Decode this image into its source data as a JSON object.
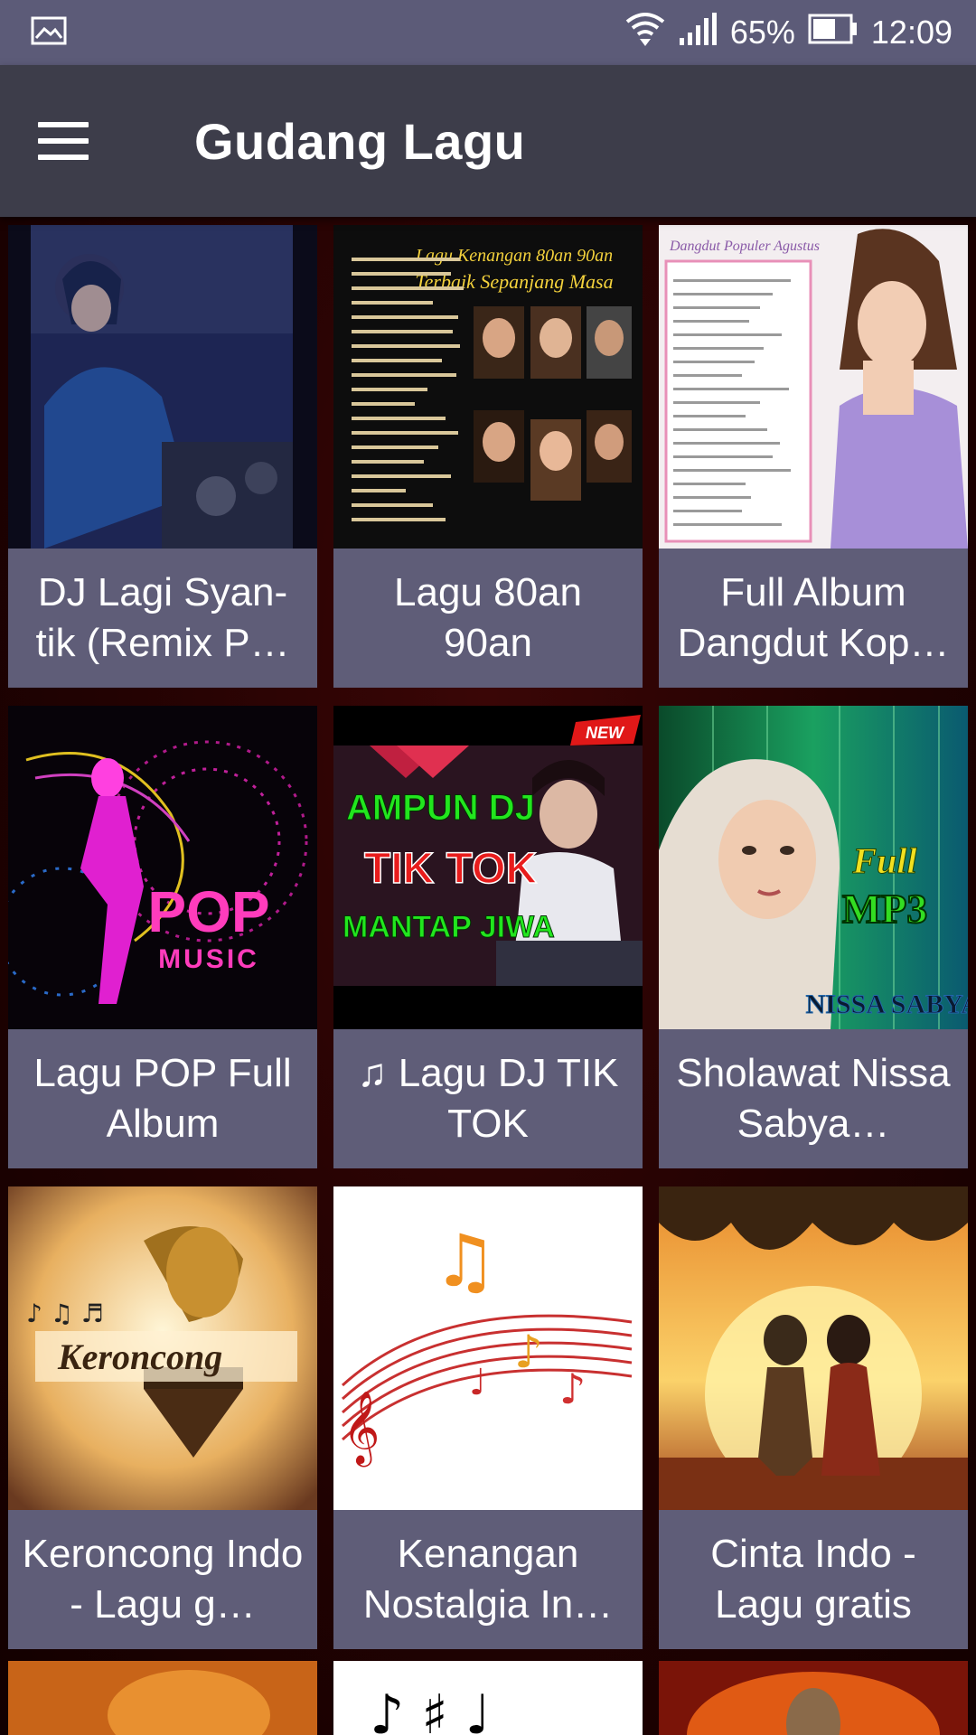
{
  "status_bar": {
    "battery": "65%",
    "time": "12:09"
  },
  "app_bar": {
    "title": "Gudang Lagu"
  },
  "cards": [
    {
      "title": "DJ Lagi Syan-tik (Remix P…",
      "thumb_text": []
    },
    {
      "title": "Lagu 80an 90an",
      "thumb_text": [
        "Lagu Kenangan 80an 90an",
        "Terbaik Sepanjang Masa"
      ]
    },
    {
      "title": "Full Album Dangdut Kop…",
      "thumb_text": [
        "Dangdut Populer Agustus"
      ]
    },
    {
      "title": "Lagu POP Full Album",
      "thumb_text": [
        "POP",
        "MUSIC"
      ]
    },
    {
      "title": "♫ Lagu DJ TIK TOK",
      "thumb_text": [
        "AMPUN DJ",
        "TIK TOK",
        "MANTAP JIWA",
        "NEW"
      ]
    },
    {
      "title": "Sholawat Nissa Sabya…",
      "thumb_text": [
        "Full",
        "MP3",
        "NISSA SABYAN"
      ]
    },
    {
      "title": "Keroncong Indo - Lagu g…",
      "thumb_text": [
        "Keroncong"
      ]
    },
    {
      "title": "Kenangan Nostalgia In…",
      "thumb_text": []
    },
    {
      "title": "Cinta Indo - Lagu gratis",
      "thumb_text": []
    }
  ]
}
